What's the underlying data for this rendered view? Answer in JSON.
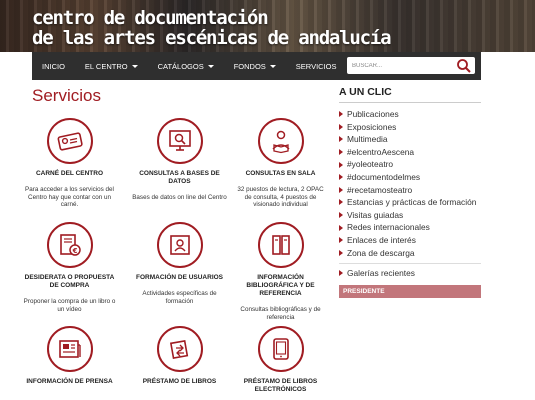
{
  "banner": {
    "line1": "centro de documentación",
    "line2": "de las artes escénicas de andalucía"
  },
  "nav": {
    "items": [
      {
        "label": "INICIO",
        "dropdown": false
      },
      {
        "label": "EL CENTRO",
        "dropdown": true
      },
      {
        "label": "CATÁLOGOS",
        "dropdown": true
      },
      {
        "label": "FONDOS",
        "dropdown": true
      },
      {
        "label": "SERVICIOS",
        "dropdown": false
      }
    ],
    "search_placeholder": "BUSCAR..."
  },
  "page": {
    "title": "Servicios"
  },
  "services": [
    {
      "name": "CARNÉ DEL CENTRO",
      "desc": "Para acceder a los servicios del Centro hay que contar con un carné.",
      "icon": "id-card-icon"
    },
    {
      "name": "CONSULTAS A BASES DE DATOS",
      "desc": "Bases de datos on line del Centro",
      "icon": "monitor-search-icon"
    },
    {
      "name": "CONSULTAS EN SALA",
      "desc": "32 puestos de lectura, 2 OPAC de consulta, 4 puestos de visionado individual",
      "icon": "reader-icon"
    },
    {
      "name": "DESIDERATA O PROPUESTA DE COMPRA",
      "desc": "Proponer la compra de un libro o un vídeo",
      "icon": "book-euro-icon"
    },
    {
      "name": "FORMACIÓN DE USUARIOS",
      "desc": "Actividades específicas de formación",
      "icon": "user-card-icon"
    },
    {
      "name": "INFORMACIÓN BIBLIOGRÁFICA Y DE REFERENCIA",
      "desc": "Consultas bibliográficas y de referencia",
      "icon": "books-icon"
    },
    {
      "name": "INFORMACIÓN DE PRENSA",
      "desc": "",
      "icon": "newspaper-icon"
    },
    {
      "name": "PRÉSTAMO DE LIBROS",
      "desc": "",
      "icon": "book-arrows-icon"
    },
    {
      "name": "PRÉSTAMO DE LIBROS ELECTRÓNICOS",
      "desc": "",
      "icon": "tablet-icon"
    }
  ],
  "sidebar": {
    "title": "A UN CLIC",
    "links": [
      "Publicaciones",
      "Exposiciones",
      "Multimedia",
      "#elcentroAescena",
      "#yoleoteatro",
      "#documentodelmes",
      "#recetamosteatro",
      "Estancias y prácticas de formación",
      "Visitas guiadas",
      "Redes internacionales",
      "Enlaces de interés",
      "Zona de descarga"
    ],
    "extra_link": "Galerías recientes",
    "presidente": "PRESIDENTE"
  },
  "colors": {
    "accent": "#a01c22",
    "navbar": "#2f2f2f",
    "presidente_bar": "#c2767b"
  }
}
